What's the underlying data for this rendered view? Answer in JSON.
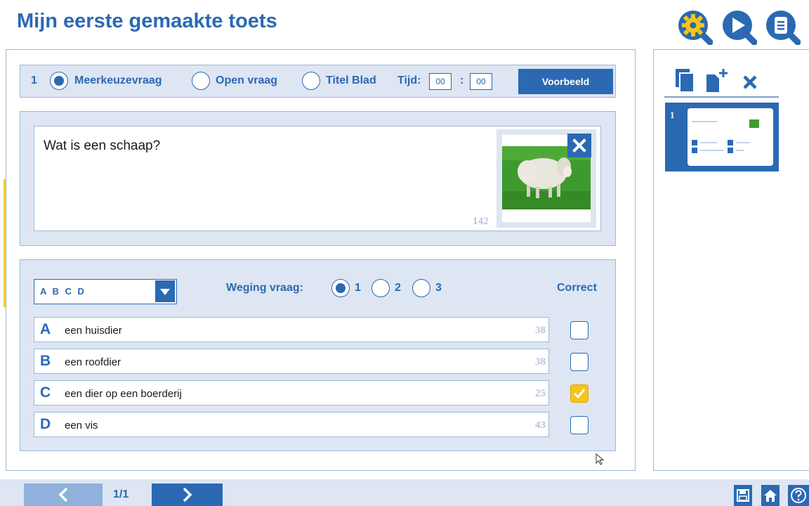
{
  "header": {
    "title": "Mijn eerste gemaakte toets",
    "icons": [
      "settings-search-icon",
      "play-search-icon",
      "list-search-icon"
    ]
  },
  "question_bar": {
    "number": "1",
    "types": [
      {
        "label": "Meerkeuzevraag",
        "selected": true
      },
      {
        "label": "Open vraag",
        "selected": false
      },
      {
        "label": "Titel Blad",
        "selected": false
      }
    ],
    "time_label": "Tijd:",
    "time_minutes": "00",
    "time_separator": ":",
    "time_seconds": "00",
    "preview_label": "Voorbeeld"
  },
  "question": {
    "text": "Wat is een schaap?",
    "counter": "142",
    "image": "sheep-photo"
  },
  "answers_panel": {
    "format_select": "A B C D",
    "weight_label": "Weging vraag:",
    "weights": [
      {
        "label": "1",
        "selected": true
      },
      {
        "label": "2",
        "selected": false
      },
      {
        "label": "3",
        "selected": false
      }
    ],
    "correct_label": "Correct",
    "answers": [
      {
        "letter": "A",
        "text": "een huisdier",
        "counter": "38",
        "correct": false
      },
      {
        "letter": "B",
        "text": "een roofdier",
        "counter": "38",
        "correct": false
      },
      {
        "letter": "C",
        "text": "een dier op een boerderij",
        "counter": "25",
        "correct": true
      },
      {
        "letter": "D",
        "text": "een vis",
        "counter": "43",
        "correct": false
      }
    ]
  },
  "sidebar": {
    "tools": [
      "copy-icon",
      "add-page-icon",
      "delete-icon"
    ],
    "thumbnails": [
      {
        "number": "1"
      }
    ]
  },
  "footer": {
    "page_indicator": "1/1",
    "icons": [
      "save-icon",
      "home-icon",
      "help-icon"
    ]
  },
  "colors": {
    "primary": "#2b69b3",
    "panel_bg": "#dde6f2",
    "accent_yellow": "#f5c518"
  }
}
